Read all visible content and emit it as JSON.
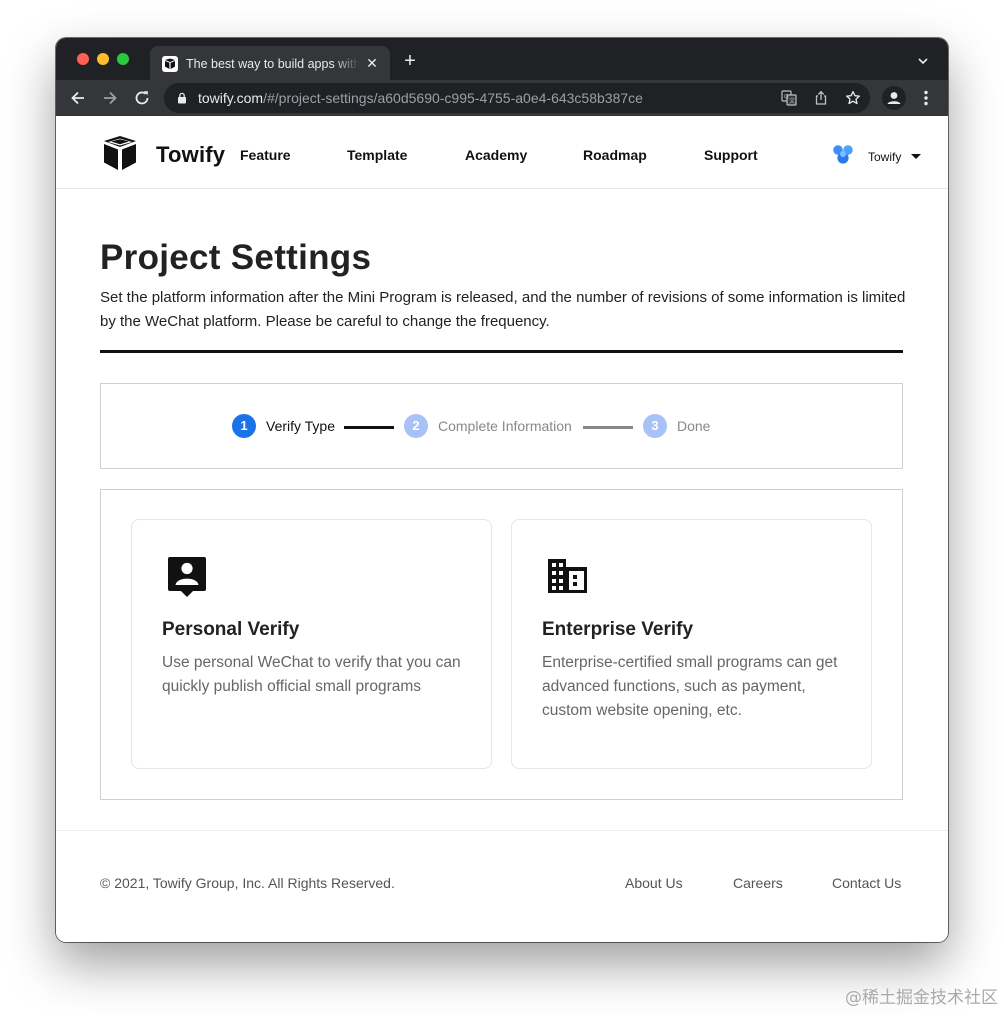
{
  "browser": {
    "tab_title": "The best way to build apps with Towify",
    "tab_close": "✕",
    "new_tab": "+",
    "url_host": "towify.com",
    "url_path": "/#/project-settings/a60d5690-c995-4755-a0e4-643c58b387ce"
  },
  "nav": {
    "brand": "Towify",
    "links": [
      "Feature",
      "Template",
      "Academy",
      "Roadmap",
      "Support"
    ],
    "user_name": "Towify"
  },
  "header": {
    "title": "Project Settings",
    "description": "Set the platform information after the Mini Program is released, and the number of revisions of some information is limited by the WeChat platform. Please be careful to change the frequency."
  },
  "stepper": {
    "current_step": 1,
    "steps": [
      {
        "number": "1",
        "label": "Verify Type"
      },
      {
        "number": "2",
        "label": "Complete Information"
      },
      {
        "number": "3",
        "label": "Done"
      }
    ]
  },
  "cards": [
    {
      "icon": "personal-badge-icon",
      "title": "Personal Verify",
      "description": "Use personal WeChat to verify that you can quickly publish official small programs"
    },
    {
      "icon": "building-icon",
      "title": "Enterprise Verify",
      "description": "Enterprise-certified small programs can get advanced functions, such as payment, custom website opening, etc."
    }
  ],
  "footer": {
    "copyright": "© 2021, Towify Group, Inc. All Rights Reserved.",
    "links": [
      "About Us",
      "Careers",
      "Contact Us"
    ]
  },
  "watermark": "@稀土掘金技术社区",
  "colors": {
    "accent": "#1a73e8",
    "step_inactive": "#a9c2f5",
    "text_primary": "#222222",
    "text_secondary": "#666666",
    "chrome_dark": "#202124",
    "chrome_tab": "#35363a"
  }
}
